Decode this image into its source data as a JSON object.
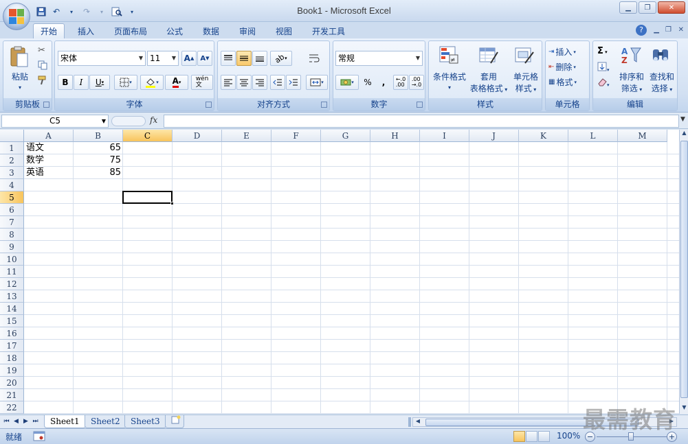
{
  "window": {
    "title": "Book1 - Microsoft Excel"
  },
  "tabs": [
    "开始",
    "插入",
    "页面布局",
    "公式",
    "数据",
    "审阅",
    "视图",
    "开发工具"
  ],
  "active_tab": "开始",
  "ribbon": {
    "clipboard": {
      "label": "剪贴板",
      "paste": "粘贴"
    },
    "font": {
      "label": "字体",
      "font_name": "宋体",
      "font_size": "11",
      "bold": "B",
      "italic": "I",
      "underline": "U",
      "wen": "wén\n文"
    },
    "alignment": {
      "label": "对齐方式"
    },
    "number": {
      "label": "数字",
      "format": "常规",
      "percent": "%",
      "comma": ","
    },
    "styles": {
      "label": "样式",
      "conditional": "条件格式",
      "table_format_1": "套用",
      "table_format_2": "表格格式",
      "cell_style_1": "单元格",
      "cell_style_2": "样式"
    },
    "cells": {
      "label": "单元格",
      "insert": "插入",
      "delete": "删除",
      "format": "格式"
    },
    "editing": {
      "label": "编辑",
      "sum": "Σ",
      "sort_1": "排序和",
      "sort_2": "筛选",
      "find_1": "查找和",
      "find_2": "选择"
    }
  },
  "formula_bar": {
    "name_box": "C5",
    "fx": "fx",
    "value": ""
  },
  "columns": [
    "A",
    "B",
    "C",
    "D",
    "E",
    "F",
    "G",
    "H",
    "I",
    "J",
    "K",
    "L",
    "M"
  ],
  "rows": [
    "1",
    "2",
    "3",
    "4",
    "5",
    "6",
    "7",
    "8",
    "9",
    "10",
    "11",
    "12",
    "13",
    "14",
    "15",
    "16",
    "17",
    "18",
    "19",
    "20",
    "21",
    "22"
  ],
  "cells": {
    "A1": "语文",
    "B1": "65",
    "A2": "数学",
    "B2": "75",
    "A3": "英语",
    "B3": "85"
  },
  "selected_cell": "C5",
  "sheets": [
    "Sheet1",
    "Sheet2",
    "Sheet3"
  ],
  "active_sheet": "Sheet1",
  "status": {
    "ready": "就绪",
    "zoom": "100%"
  },
  "watermark": "最需教育",
  "colors": {
    "selection": "#000000",
    "header_selected": "#f8c45c",
    "ribbon": "#d2e0f2"
  }
}
